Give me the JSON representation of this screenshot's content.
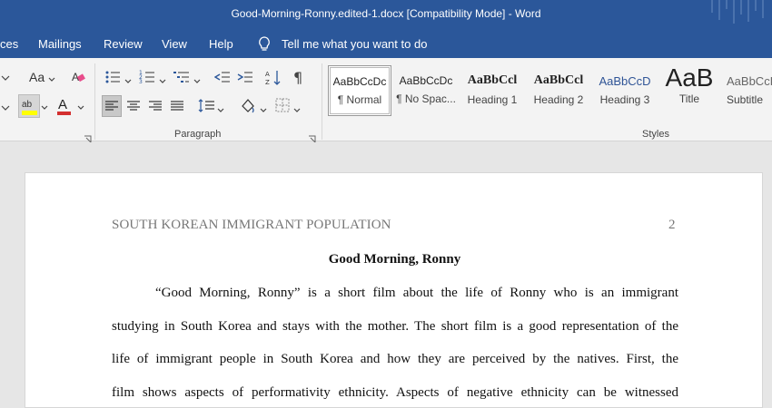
{
  "window": {
    "title": "Good-Morning-Ronny.edited-1.docx [Compatibility Mode]  -  Word"
  },
  "menu": {
    "items": [
      "ces",
      "Mailings",
      "Review",
      "View",
      "Help"
    ],
    "tell_me": "Tell me what you want to do"
  },
  "ribbon": {
    "paragraph_label": "Paragraph",
    "styles_label": "Styles",
    "font_change_case": "Aa",
    "styles": [
      {
        "sample": "AaBbCcDc",
        "name": "¶ Normal"
      },
      {
        "sample": "AaBbCcDc",
        "name": "¶ No Spac..."
      },
      {
        "sample": "AaBbCcl",
        "name": "Heading 1"
      },
      {
        "sample": "AaBbCcl",
        "name": "Heading 2"
      },
      {
        "sample": "AaBbCcD",
        "name": "Heading 3"
      },
      {
        "sample": "AaB",
        "name": "Title"
      },
      {
        "sample": "AaBbCcD",
        "name": "Subtitle"
      }
    ]
  },
  "document": {
    "running_head": "SOUTH KOREAN IMMIGRANT POPULATION",
    "page_number": "2",
    "title": "Good Morning, Ronny",
    "lines": [
      "“Good Morning, Ronny” is a short film about the life of Ronny who is an immigrant",
      "studying in South Korea and stays with the mother. The short film is a good representation of the",
      "life of immigrant people in South Korea and how they are perceived by the natives. First, the",
      "film shows aspects of performativity ethnicity. Aspects of negative ethnicity can be witnessed"
    ]
  },
  "colors": {
    "word_blue": "#2b579a",
    "ribbon_bg": "#f3f3f3",
    "font_color_red": "#d32f2f",
    "highlight_yellow": "#ffff00"
  }
}
